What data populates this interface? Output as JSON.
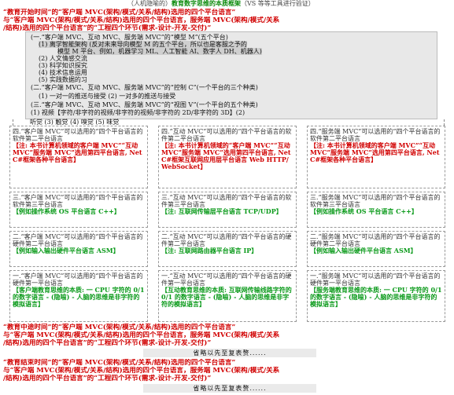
{
  "top_note": {
    "prefix": "（人机隐喻的）",
    "highlight": "教育数字思维的本质框架",
    "suffix": "（VS 等等工具进行验证）"
  },
  "header": {
    "line1_a": "“教育开始时间”",
    "line1_b": "的“客户端 MVC(架构/模式/关系/结构)选用的四个平台语言”",
    "line2": "与“客户端 MVC(架构/模式/关系/结构)选用的四个平台语言，服务端 MVC(架构/模式/关系",
    "line3": "/结构)选用的四个平台语言”的“工程四个环节(需求-设计-开发-交付)”"
  },
  "banner": {
    "l1": "(一.“客户端 MVC、互动 MVC、服务端 MVC”的“模型 M”(五个平台)",
    "l2": "(1) 离学智能架构 (反对未来导向模型 M 的五个平台，所以也是客服之予的",
    "l3": "模型 M 平台、例如，机器学习 ML、人工智能 AI、数字人 DH、机器人)",
    "l4": "(2) 人文情感交流",
    "l5": "(3) 科学知识探究",
    "l6": "(4) 技术信息运用",
    "l7": "(5) 实践数据的习",
    "l8": "(二.“客户端 MVC、互动 MVC、服务端 MVC”的“控制 C”(一个平台的三个种类)",
    "l9": "(1) 一对一的推送与接受 (2) 一对多的推送与接受",
    "l10": "(三.“客户端 MVC、互动 MVC、服务端 MVC”的“视图 V”(一个平台的五个种类)",
    "l11": "(1) 视频【字符/非字符的视频/非字符的视频/非字符的 2D/非字符的 3D】(2)",
    "l12": "听觉 (3) 触觉 (4) 嗅觉 (5) 味觉"
  },
  "cells": [
    {
      "tx": "四.“客户端 MVC”可以选用的“四个平台语言的软件第二平台语言",
      "rd": "【注: 本书计算机领域的客户端 MVC”“互动 MVC”服务端 MVC”选用第四平台语言, Net C#框架各种平台语言】",
      "gr": ""
    },
    {
      "tx": "四.“互动 MVC”可以选用的“四个平台语言的软件第二平台语言",
      "rd": "【注: 本书计算机领域的“客户端 MVC”“互动 MVC”服务端 MVC”选用第四平台语言, Net C#框架互联网应用层平台语言 Web HTTP/WebSocket】",
      "gr": ""
    },
    {
      "tx": "四.“服务端 MVC”可以选用的“四个平台语言的软件第二平台语言",
      "rd": "【注: 本书计算机领域的客户端 MVC”“互动 MVC”服务端 MVC”选用第四平台语言, Net C#框架各种平台语言】",
      "gr": ""
    },
    {
      "tx": "三.“客户端 MVC”可以选用的“四个平台语言的软件第三平台语言",
      "rd": "",
      "gr": "【例如操作系统 OS 平台语言 C++】"
    },
    {
      "tx": "三.“互动 MVC”可以选用的“四个平台语言的软件第三平台语言",
      "rd": "",
      "gr": "【注: 互联网传输层平台语言 TCP/UDP】"
    },
    {
      "tx": "三.“服务端 MVC”可以选用的“四个平台语言的软件第三平台语言",
      "rd": "",
      "gr": "【例如操作系统 OS 平台语言 C++】"
    },
    {
      "tx": "二.“客户端 MVC”可以选用的“四个平台语言的硬件第二平台语言",
      "rd": "",
      "gr": "【例如输入输出硬件平台语言 ASM】"
    },
    {
      "tx": "二.“互动 MVC”可以选用的“四个平台语言的硬件第二平台语言",
      "rd": "",
      "gr": "【注: 互联网路由器平台语言 IP】"
    },
    {
      "tx": "二.“服务端 MVC”可以选用的“四个平台语言的硬件第二平台语言",
      "rd": "",
      "gr": "【例如输入输出硬件平台语言 ASM】"
    },
    {
      "tx": "一.“客户端 MVC”可以选用的“四个平台语言的硬件第一平台语言",
      "rd": "",
      "gr": "【客户端教育思维的本质: 一 CPU 字符的 0/1 的数字语言 - (隐喻) - 人脑的思维是非字符的模拟语言】"
    },
    {
      "tx": "一.“互动 MVC”可以选用的“四个平台语言的硬件第一平台语言",
      "rd": "",
      "gr": "【互动教育思维的本质: 互联网传输线路字符的 0/1 的数字语言 - (隐喻) - 人脑的思维是非字符的模拟语言】"
    },
    {
      "tx": "一.“服务端 MVC”可以选用的“四个平台语言的硬件第一平台语言",
      "rd": "",
      "gr": "【服务端教育思维的本质: 一 CPU 字符的 0/1 的数字语言 - (隐喻) - 人脑的思维是非字符的模拟语言】"
    }
  ],
  "footer1": {
    "a": "“教育中途时间”",
    "b": "的“客户端 MVC(架构/模式/关系/结构)选用的四个平台语言”",
    "c": "与“客户端 MVC(架构/模式/关系/结构)选用的四个平台语言，服务端 MVC(架构/模式/关系",
    "d": "/结构)选用的四个平台语言”的“工程四个环节(需求-设计-开发-交付)”"
  },
  "omit1": "省略以先至复表赘......",
  "footer2": {
    "a": "“教育结束时间”",
    "b": "的“客户端 MVC(架构/模式/关系/结构)选用的四个平台语言”",
    "c": "与“客户端 MVC(架构/模式/关系/结构)选用的四个平台语言，服务端 MVC(架构/模式/关系",
    "d": "/结构)选用的四个平台语言”的“工程四个环节(需求-设计-开发-交付)”"
  },
  "omit2": "省略以先至复表赘......"
}
